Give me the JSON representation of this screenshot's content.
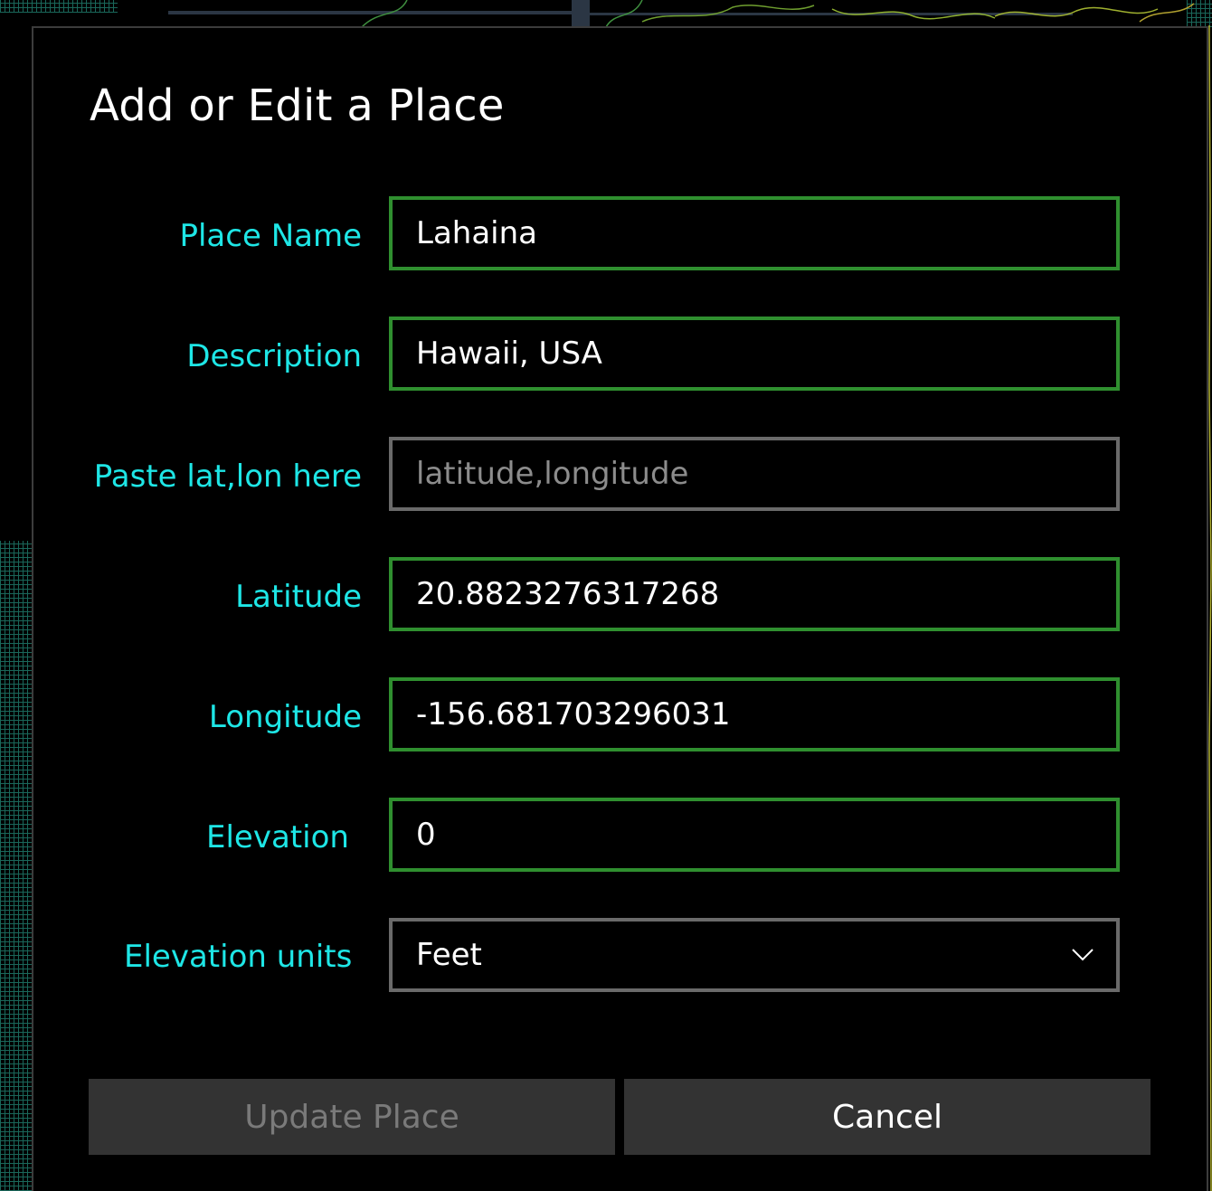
{
  "dialog": {
    "title": "Add or Edit a Place"
  },
  "form": {
    "place_name": {
      "label": "Place Name",
      "value": "Lahaina"
    },
    "description": {
      "label": "Description",
      "value": "Hawaii, USA"
    },
    "latlon": {
      "label": "Paste lat,lon here",
      "value": "",
      "placeholder": "latitude,longitude"
    },
    "latitude": {
      "label": "Latitude",
      "value": "20.8823276317268"
    },
    "longitude": {
      "label": "Longitude",
      "value": "-156.681703296031"
    },
    "elevation": {
      "label": "Elevation",
      "value": "0"
    },
    "elevation_units": {
      "label": "Elevation units",
      "selected": "Feet"
    }
  },
  "buttons": {
    "update_label": "Update Place",
    "cancel_label": "Cancel"
  },
  "colors": {
    "label_accent": "#1ee6e6",
    "field_border_active": "#2f8f2f",
    "field_border_inactive": "#6a6a6a",
    "button_bg": "#333333"
  },
  "icons": {
    "dropdown": "chevron-down-icon"
  }
}
